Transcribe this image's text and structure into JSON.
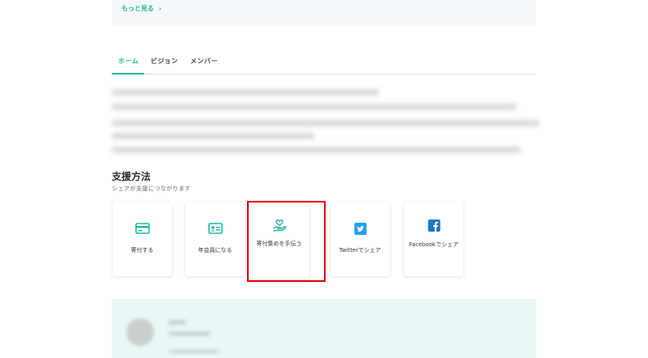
{
  "more_link": {
    "label": "もっと見る",
    "chevron": "›"
  },
  "tabs": [
    {
      "label": "ホーム",
      "active": true
    },
    {
      "label": "ビジョン",
      "active": false
    },
    {
      "label": "メンバー",
      "active": false
    }
  ],
  "support": {
    "title": "支援方法",
    "subtitle": "シェアが支援につながります",
    "cards": [
      {
        "label": "寄付する",
        "icon": "credit-card-icon"
      },
      {
        "label": "年会員になる",
        "icon": "member-card-icon"
      },
      {
        "label": "寄付集めを手伝う",
        "icon": "hand-heart-icon"
      },
      {
        "label": "Twitterでシェア",
        "icon": "twitter-icon"
      },
      {
        "label": "Facebookでシェア",
        "icon": "facebook-icon"
      }
    ]
  },
  "colors": {
    "accent": "#1fb7a4",
    "highlight": "#e00000",
    "twitter": "#1da1f2",
    "facebook": "#1877c2"
  }
}
